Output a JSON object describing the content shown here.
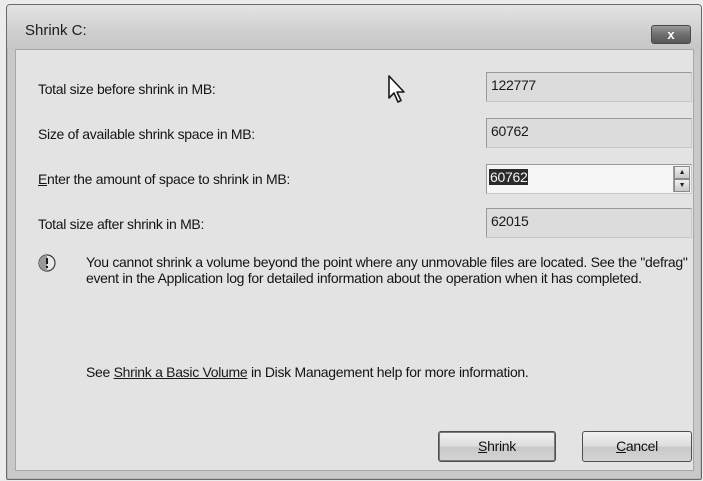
{
  "window": {
    "title": "Shrink C:",
    "close_label": "x"
  },
  "fields": {
    "total_before": {
      "label": "Total size before shrink in MB:",
      "value": "122777"
    },
    "available": {
      "label": "Size of available shrink space in MB:",
      "value": "60762"
    },
    "amount": {
      "label_mnemonic": "E",
      "label_rest": "nter the amount of space to shrink in MB:",
      "value": "60762"
    },
    "total_after": {
      "label": "Total size after shrink in MB:",
      "value": "62015"
    }
  },
  "info": {
    "icon": "info-icon",
    "text": "You cannot shrink a volume beyond the point where any unmovable files are located. See the \"defrag\" event in the Application log for detailed information about the operation when it has completed."
  },
  "help": {
    "prefix": "See ",
    "link_text": "Shrink a Basic Volume",
    "suffix": " in Disk Management help for more information."
  },
  "buttons": {
    "shrink": {
      "mnemonic": "S",
      "rest": "hrink"
    },
    "cancel": {
      "mnemonic": "C",
      "rest": "ancel"
    }
  }
}
